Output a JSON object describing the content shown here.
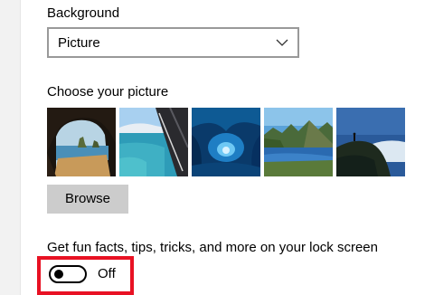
{
  "background": {
    "label": "Background",
    "dropdown_value": "Picture"
  },
  "picture": {
    "label": "Choose your picture",
    "thumbnails": [
      {
        "subject": "sea cave with beach and rock arches"
      },
      {
        "subject": "tropical coast with turquoise water seen through window"
      },
      {
        "subject": "blue ice cave"
      },
      {
        "subject": "mountain lake with green cliffs"
      },
      {
        "subject": "hiker on hillside above clouds"
      }
    ],
    "browse_label": "Browse"
  },
  "lock_screen": {
    "fun_facts_label": "Get fun facts, tips, tricks, and more on your lock screen",
    "toggle_state": "Off",
    "toggle_on": false
  },
  "colors": {
    "highlight": "#e81123",
    "button_bg": "#cccccc",
    "dropdown_border": "#999999"
  },
  "icons": {
    "dropdown": "chevron-down-icon"
  }
}
